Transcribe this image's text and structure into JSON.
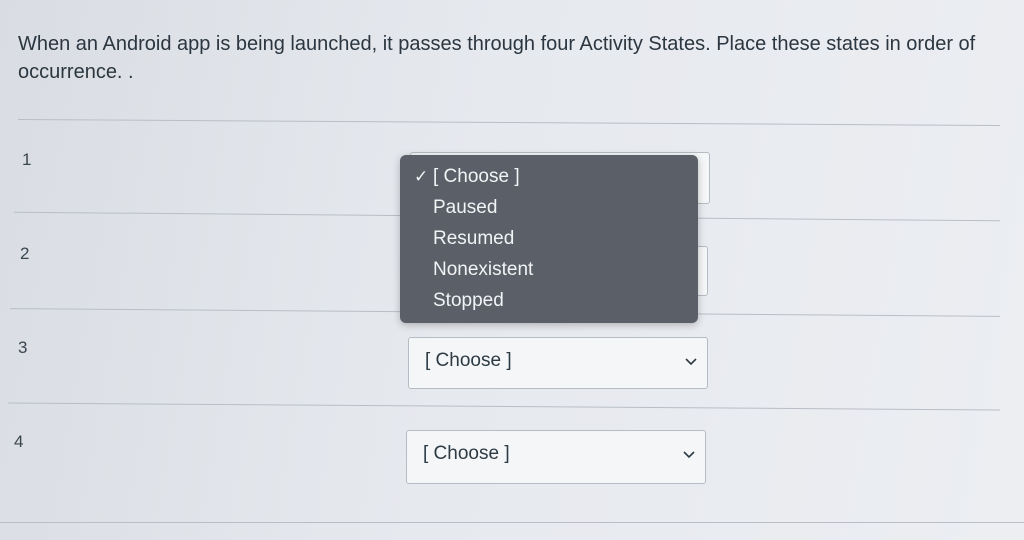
{
  "question": {
    "text": "When an Android app is being launched, it passes through four Activity States.  Place these states in order of occurrence. ."
  },
  "rows": [
    {
      "number": "1",
      "selected": ""
    },
    {
      "number": "2",
      "selected": ""
    },
    {
      "number": "3",
      "selected": "[ Choose ]"
    },
    {
      "number": "4",
      "selected": "[ Choose ]"
    }
  ],
  "dropdown": {
    "options": [
      {
        "label": "[ Choose ]",
        "checked": true
      },
      {
        "label": "Paused",
        "checked": false
      },
      {
        "label": "Resumed",
        "checked": false
      },
      {
        "label": "Nonexistent",
        "checked": false
      },
      {
        "label": "Stopped",
        "checked": false
      }
    ],
    "check_icon": "checkmark-icon"
  },
  "icons": {
    "chevron": "chevron-down-icon"
  }
}
